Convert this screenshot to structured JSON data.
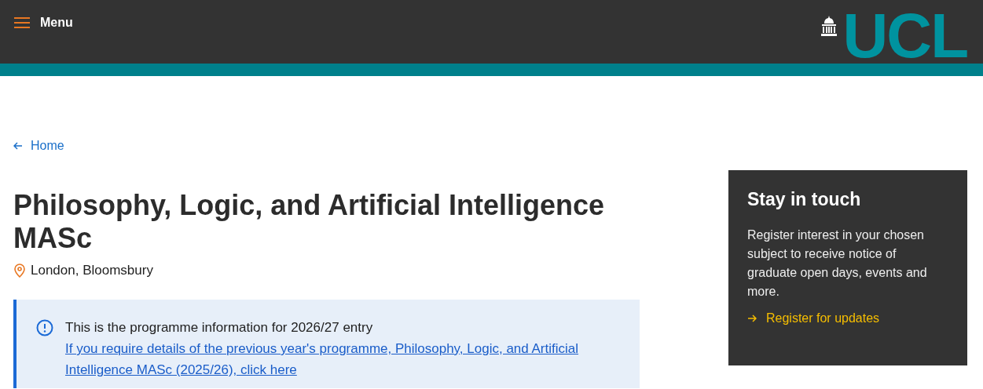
{
  "header": {
    "menu_label": "Menu",
    "logo_text": "UCL"
  },
  "breadcrumb": {
    "label": "Home"
  },
  "title": "Philosophy, Logic, and Artificial Intelligence MASc",
  "location": "London, Bloomsbury",
  "notice": {
    "text": "This is the programme information for 2026/27 entry",
    "link": "If you require details of the previous year's programme, Philosophy, Logic, and Artificial Intelligence MASc (2025/26), click here"
  },
  "sidebar": {
    "title": "Stay in touch",
    "body": "Register interest in your chosen subject to receive notice of graduate open days, events and more.",
    "link": "Register for updates"
  }
}
